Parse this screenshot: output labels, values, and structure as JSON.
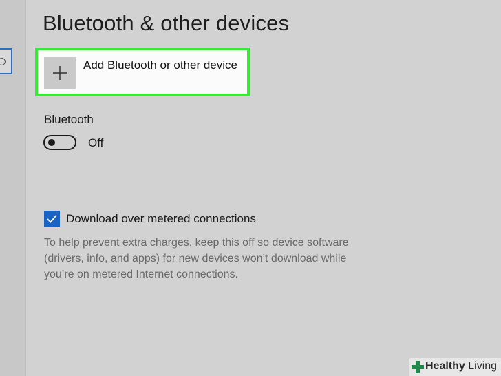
{
  "page": {
    "title": "Bluetooth & other devices"
  },
  "add_device": {
    "label": "Add Bluetooth or other device",
    "icon": "plus-icon",
    "highlight_color": "#3ee63a"
  },
  "bluetooth": {
    "label": "Bluetooth",
    "toggle_state": "Off",
    "toggle_on": false
  },
  "metered": {
    "checked": true,
    "label": "Download over metered connections",
    "help_text": "To help prevent extra charges, keep this off so device software (drivers, info, and apps) for new devices won’t download while you’re on metered Internet connections.",
    "accent_color": "#1b63c3"
  },
  "watermark": {
    "brand_bold": "Healthy",
    "brand_light": "Living"
  }
}
